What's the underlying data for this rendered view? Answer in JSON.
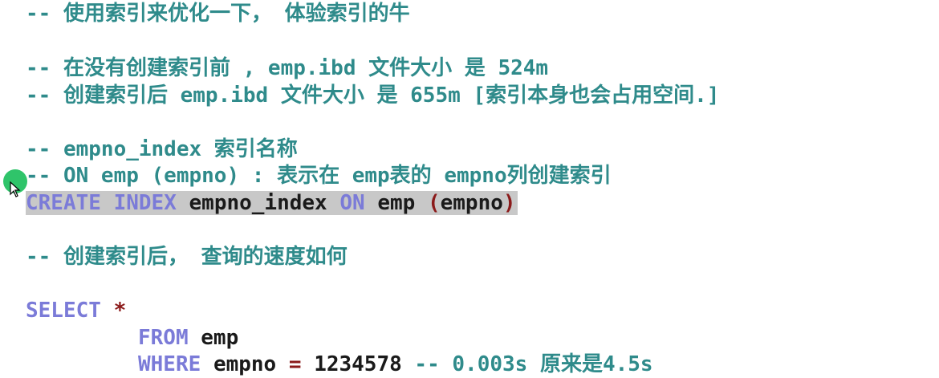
{
  "editor": {
    "line1": "-- 使用索引来优化一下， 体验索引的牛",
    "line2": "-- 在没有创建索引前 , emp.ibd 文件大小 是 524m",
    "line3": "-- 创建索引后 emp.ibd 文件大小 是 655m [索引本身也会占用空间.]",
    "line4": "-- empno_index 索引名称",
    "line5": "-- ON emp (empno) : 表示在 emp表的 empno列创建索引",
    "create_stmt": {
      "kw_create": "CREATE",
      "kw_index": "INDEX",
      "index_name": "empno_index",
      "kw_on": "ON",
      "table": "emp",
      "paren_open": "(",
      "column": "empno",
      "paren_close": ")"
    },
    "line7": "-- 创建索引后， 查询的速度如何",
    "select_stmt": {
      "kw_select": "SELECT",
      "star": "*",
      "kw_from": "FROM",
      "table": "emp",
      "kw_where": "WHERE",
      "column": "empno",
      "eq": "=",
      "value": "1234578",
      "comment": "-- 0.003s 原来是4.5s"
    }
  }
}
